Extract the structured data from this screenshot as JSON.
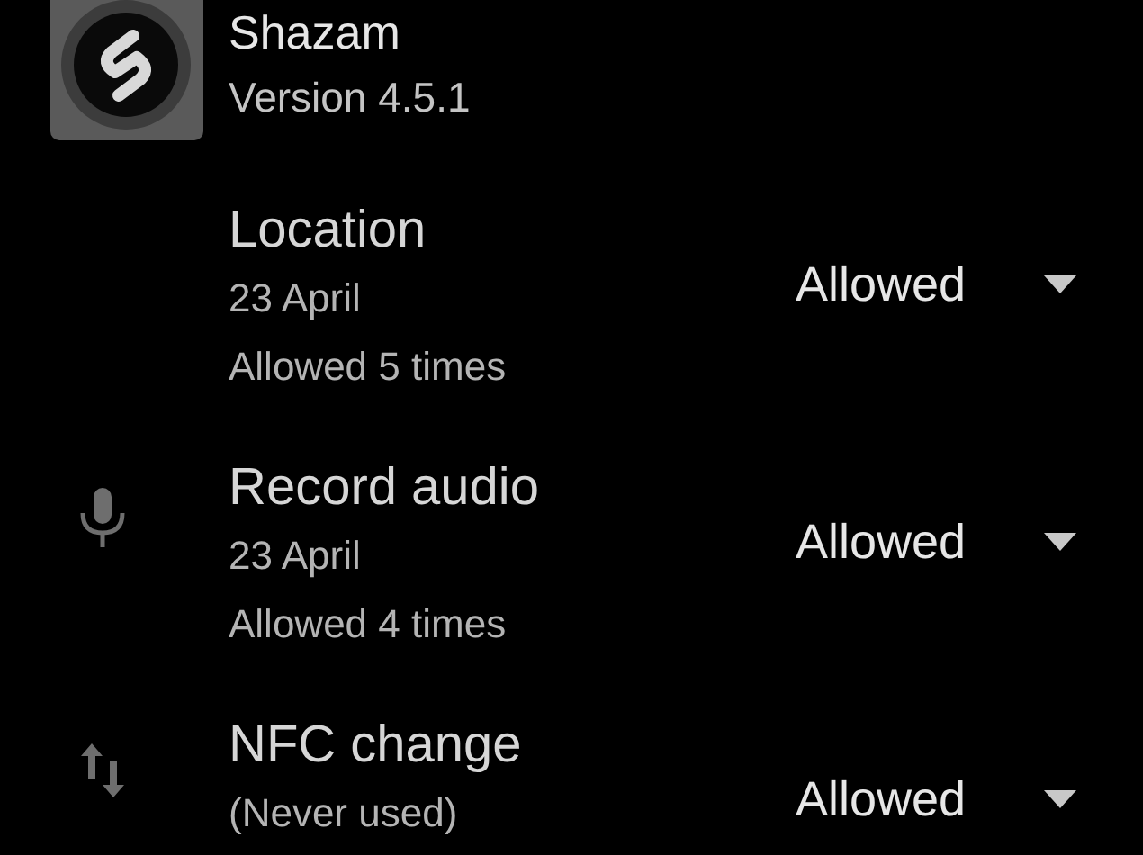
{
  "app": {
    "name": "Shazam",
    "version": "Version 4.5.1"
  },
  "permissions": [
    {
      "kind": "location",
      "title": "Location",
      "details": [
        "23 April",
        "Allowed 5 times"
      ],
      "value": "Allowed"
    },
    {
      "kind": "microphone",
      "title": "Record audio",
      "details": [
        "23 April",
        "Allowed 4 times"
      ],
      "value": "Allowed"
    },
    {
      "kind": "transfer",
      "title": "NFC change",
      "details": [
        "(Never used)"
      ],
      "value": "Allowed"
    }
  ]
}
